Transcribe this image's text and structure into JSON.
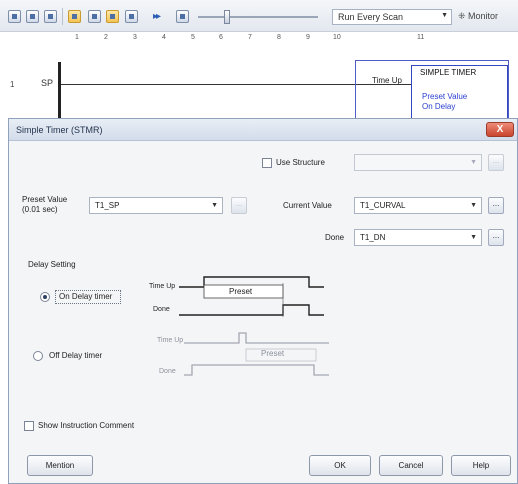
{
  "toolbar": {
    "scan_mode": "Run Every Scan",
    "monitor_label": "Monitor"
  },
  "ruler": {
    "ticks": [
      "1",
      "2",
      "3",
      "4",
      "5",
      "6",
      "7",
      "8",
      "9",
      "10",
      "11"
    ]
  },
  "ladder": {
    "rung_number": "1",
    "rung_label": "SP",
    "instruction": {
      "name": "SIMPLE TIMER",
      "time_up": "Time Up",
      "preset_value": "Preset Value",
      "on_delay": "On Delay"
    }
  },
  "dialog": {
    "title": "Simple Timer (STMR)",
    "close_label": "X",
    "use_structure": {
      "label": "Use Structure",
      "checked": false,
      "value": ""
    },
    "preset_value": {
      "label_line1": "Preset Value",
      "label_line2": "(0.01 sec)",
      "value": "T1_SP"
    },
    "current_value": {
      "label": "Current Value",
      "value": "T1_CURVAL"
    },
    "done": {
      "label": "Done",
      "value": "T1_DN"
    },
    "ellipsis": "...",
    "delay_setting": {
      "heading": "Delay Setting",
      "on_delay": {
        "label": "On Delay timer",
        "selected": true,
        "time_up": "Time Up",
        "done": "Done",
        "preset": "Preset"
      },
      "off_delay": {
        "label": "Off Delay timer",
        "selected": false,
        "time_up": "Time Up",
        "done": "Done",
        "preset": "Preset"
      }
    },
    "show_comment": {
      "label": "Show Instruction Comment",
      "checked": false
    },
    "buttons": {
      "mention": "Mention",
      "ok": "OK",
      "cancel": "Cancel",
      "help": "Help"
    }
  },
  "colors": {
    "instruction_border": "#3347c2",
    "instruction_text": "#2a3fd0",
    "close_button": "#c9452e",
    "active_toolbar_button": "#f4c455"
  }
}
